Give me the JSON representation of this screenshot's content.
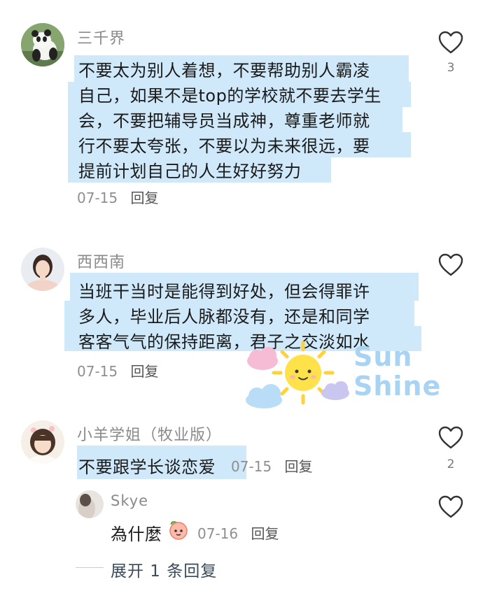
{
  "comments": [
    {
      "username": "三千界",
      "lines": [
        "不要太为别人着想，不要帮助别人霸凌",
        "自己，如果不是top的学校就不要去学生",
        "会，不要把辅导员当成神，尊重老师就",
        "行不要太夸张，不要以为未来很远，要",
        "提前计划自己的人生好好努力"
      ],
      "date": "07-15",
      "reply_label": "回复",
      "likes": "3"
    },
    {
      "username": "西西南",
      "lines": [
        "当班干当时是能得到好处，但会得罪许",
        "多人，毕业后人脉都没有，还是和同学",
        "客客气气的保持距离，君子之交淡如水"
      ],
      "date": "07-15",
      "reply_label": "回复"
    },
    {
      "username": "小羊学姐（牧业版）",
      "text": "不要跟学长谈恋爱",
      "date": "07-15",
      "reply_label": "回复",
      "likes": "2",
      "reply": {
        "username": "Skye",
        "text": "為什麼",
        "date": "07-16",
        "reply_label": "回复"
      }
    }
  ],
  "expand_label": "展开 1 条回复",
  "watermark": {
    "line1": "Sun",
    "line2": "Shine"
  },
  "colors": {
    "highlight": "#cfe9fb",
    "watermark_text": "#a9d3f2",
    "sun": "#ffe24a"
  }
}
